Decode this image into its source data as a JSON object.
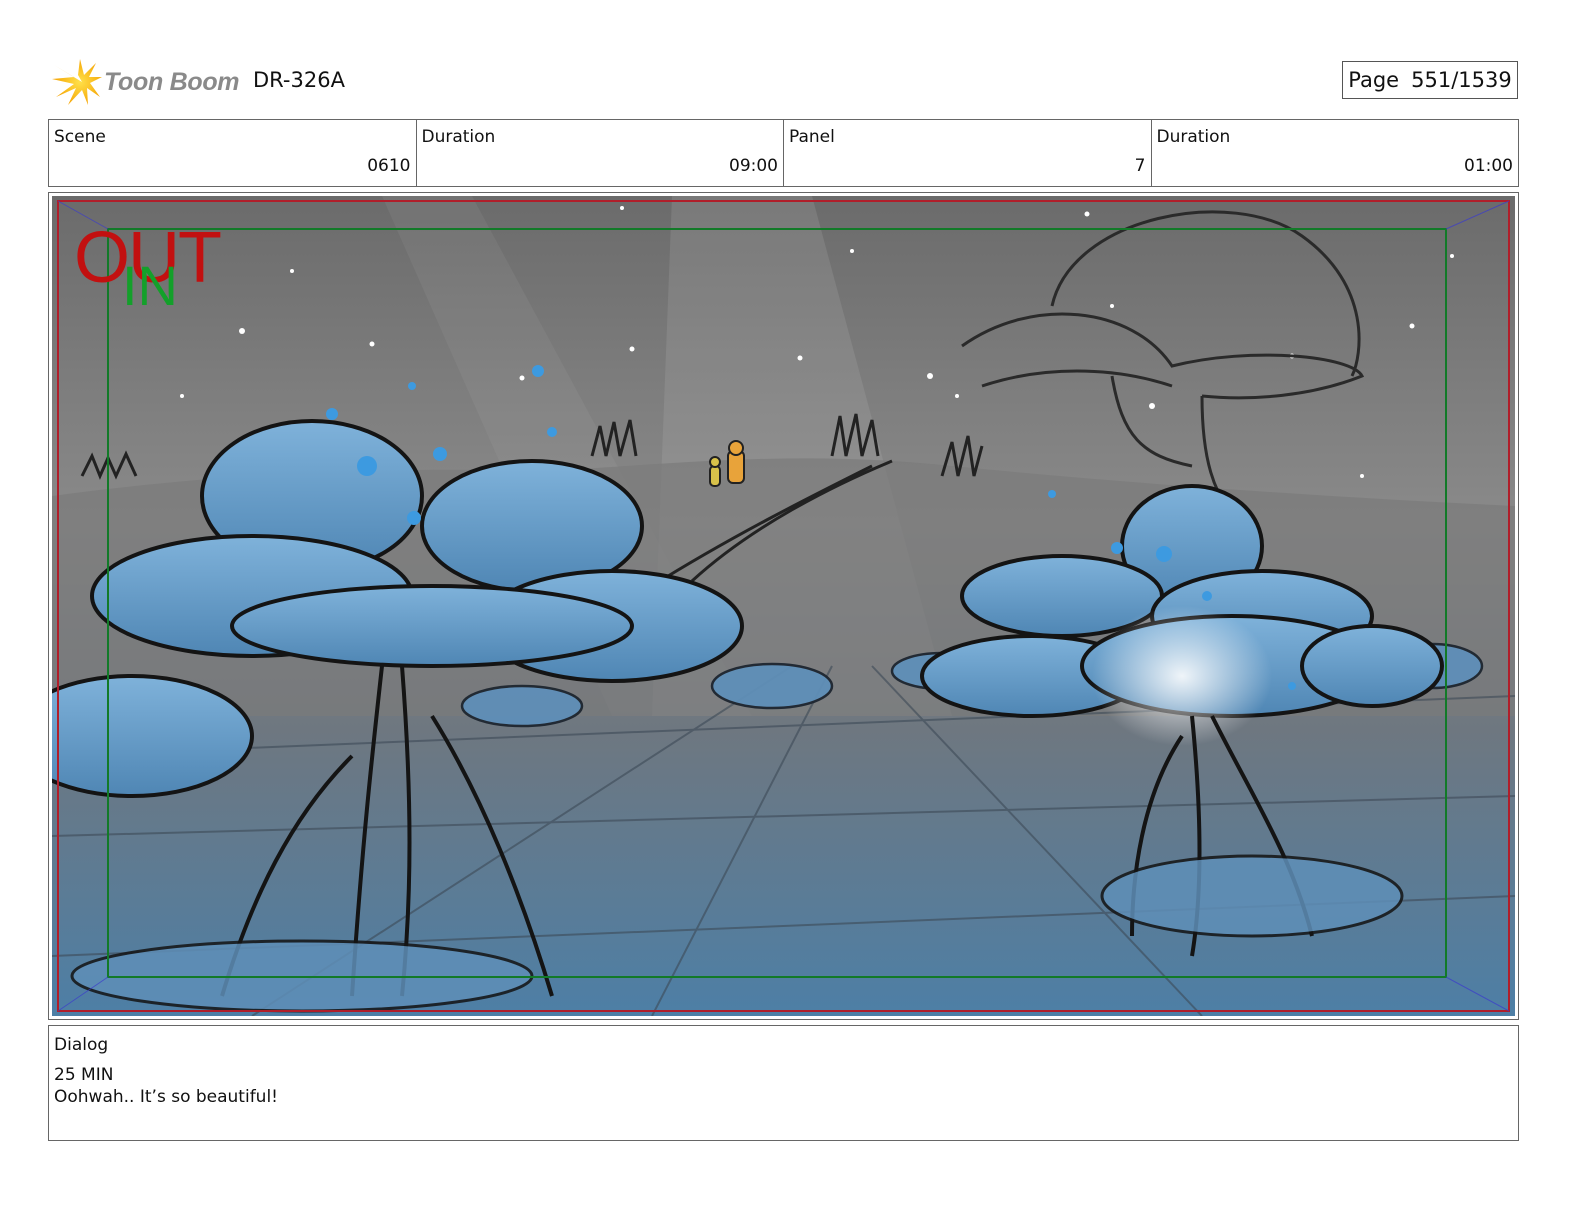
{
  "header": {
    "logo_text": "Toon Boom",
    "project_id": "DR-326A",
    "page_label": "Page",
    "page_value": "551/1539"
  },
  "info": {
    "scene_label": "Scene",
    "scene_value": "0610",
    "scene_duration_label": "Duration",
    "scene_duration_value": "09:00",
    "panel_label": "Panel",
    "panel_value": "7",
    "panel_duration_label": "Duration",
    "panel_duration_value": "01:00"
  },
  "panel": {
    "out_marker": "OUT",
    "in_marker": "IN",
    "colors": {
      "out": "#c21010",
      "in": "#13a02a",
      "flower_blue": "#5a9fd1"
    }
  },
  "dialog": {
    "label": "Dialog",
    "lines": [
      "25 MIN",
      "Oohwah.. It’s so beautiful!"
    ]
  },
  "icons": {
    "logo": "starburst-logo-icon"
  }
}
